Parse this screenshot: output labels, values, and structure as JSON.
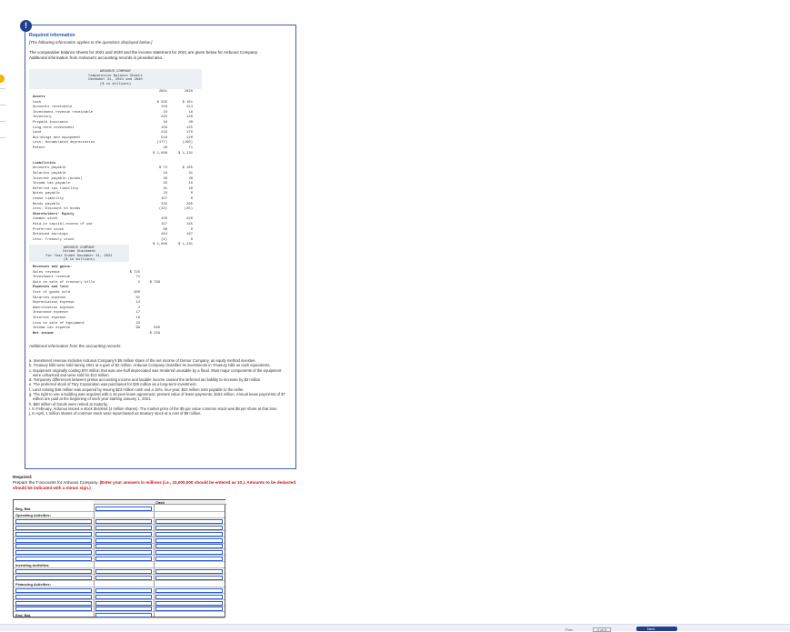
{
  "info": {
    "title": "Required information",
    "subtitle": "[The following information applies to the questions displayed below.]",
    "intro": "The comparative balance sheets for 2021 and 2020 and the income statement for 2021 are given below for Arduous Company. Additional information from Arduous's accounting records is provided also."
  },
  "balance_sheet": {
    "head": [
      "ARDUOUS COMPANY",
      "Comparative Balance Sheets",
      "December 31, 2021 and 2020",
      "($ in millions)"
    ],
    "years": [
      "2021",
      "2020"
    ],
    "rows": [
      {
        "label": "Assets",
        "a": "",
        "b": "",
        "bold": true
      },
      {
        "label": "Cash",
        "a": "$   335",
        "b": "$   161"
      },
      {
        "label": "Accounts receivable",
        "a": "210",
        "b": "214"
      },
      {
        "label": "Investment revenue receivable",
        "a": "24",
        "b": "16"
      },
      {
        "label": "Inventory",
        "a": "225",
        "b": "120"
      },
      {
        "label": "Prepaid insurance",
        "a": "16",
        "b": "28"
      },
      {
        "label": "Long-term investment",
        "a": "156",
        "b": "125"
      },
      {
        "label": "Land",
        "a": "216",
        "b": "170"
      },
      {
        "label": "Buildings and equipment",
        "a": "518",
        "b": "120"
      },
      {
        "label": "Less: Accumulated depreciation",
        "a": "(177)",
        "b": "(160)"
      },
      {
        "label": "Patent",
        "a": "40",
        "b": "71"
      },
      {
        "label": "",
        "a": "$ 1,606",
        "b": "$ 1,231"
      },
      {
        "label": "",
        "a": "",
        "b": ""
      },
      {
        "label": "Liabilities",
        "a": "",
        "b": "",
        "bold": true
      },
      {
        "label": "Accounts payable",
        "a": "$    73",
        "b": "$   185"
      },
      {
        "label": "Salaries payable",
        "a": "16",
        "b": "31"
      },
      {
        "label": "Interest payable (bonds)",
        "a": "28",
        "b": "26"
      },
      {
        "label": "Income tax payable",
        "a": "32",
        "b": "16"
      },
      {
        "label": "Deferred tax liability",
        "a": "31",
        "b": "28"
      },
      {
        "label": "Notes payable",
        "a": "23",
        "b": "0"
      },
      {
        "label": "Lease liability",
        "a": "157",
        "b": "0"
      },
      {
        "label": "Bonds payable",
        "a": "235",
        "b": "295"
      },
      {
        "label": "Less: Discount on bonds",
        "a": "(23)",
        "b": "(25)"
      },
      {
        "label": "Shareholders' Equity",
        "a": "",
        "b": "",
        "bold": true
      },
      {
        "label": "Common stock",
        "a": "420",
        "b": "420"
      },
      {
        "label": "Paid-in capital-excess of par",
        "a": "157",
        "b": "145"
      },
      {
        "label": "Preferred stock",
        "a": "96",
        "b": "0"
      },
      {
        "label": "Retained earnings",
        "a": "404",
        "b": "197"
      },
      {
        "label": "Less: Treasury stock",
        "a": "(9)",
        "b": "0"
      },
      {
        "label": "",
        "a": "$ 1,606",
        "b": "$ 1,231"
      }
    ]
  },
  "income_statement": {
    "head": [
      "ARDUOUS COMPANY",
      "Income Statement",
      "For Year Ended December 31, 2021",
      "($ in millions)"
    ],
    "rows": [
      {
        "label": "Revenues and gains:",
        "a": "",
        "b": "",
        "bold": true
      },
      {
        "label": "Sales revenue",
        "a": "$ 725",
        "b": ""
      },
      {
        "label": "Investment revenue",
        "a": "71",
        "b": ""
      },
      {
        "label": "Gain on sale of treasury bills",
        "a": "2",
        "b": "$ 798"
      },
      {
        "label": "Expenses and loss:",
        "a": "",
        "b": "",
        "bold": true
      },
      {
        "label": "Cost of goods sold",
        "a": "300",
        "b": ""
      },
      {
        "label": "Salaries expense",
        "a": "91",
        "b": ""
      },
      {
        "label": "Depreciation expense",
        "a": "12",
        "b": ""
      },
      {
        "label": "Amortization expense",
        "a": "2",
        "b": ""
      },
      {
        "label": "Insurance expense",
        "a": "17",
        "b": ""
      },
      {
        "label": "Interest expense",
        "a": "18",
        "b": ""
      },
      {
        "label": "Loss on sale of equipment",
        "a": "22",
        "b": ""
      },
      {
        "label": "Income tax expense",
        "a": "98",
        "b": "560"
      },
      {
        "label": "Net income",
        "a": "",
        "b": "$ 238",
        "bold": true
      }
    ]
  },
  "additional": {
    "title": "Additional information from the accounting records:",
    "notes": [
      "a. Investment revenue includes Arduous Company's $6 million share of the net income of Demur Company, an equity method investee.",
      "b. Treasury bills were sold during 2021 at a gain of $2 million. Arduous Company classifies its investments in Treasury bills as cash equivalents.",
      "c. Equipment originally costing $70 million that was one-half depreciated was rendered unusable by a flood. Most major components of the equipment were unharmed and were sold for $13 million.",
      "d. Temporary differences between pretax accounting income and taxable income caused the deferred tax liability to increase by $3 million.",
      "e. The preferred stock of Tory Corporation was purchased for $25 million as a long-term investment.",
      "f. Land costing $46 million was acquired by issuing $23 million cash and a 15%, four-year, $23 million note payable to the seller.",
      "g. The right to use a building was acquired with a 15-year lease agreement; present value of lease payments, $164 million. Annual lease payments of $7 million are paid at the beginning of each year starting January 1, 2021.",
      "h. $60 million of bonds were retired at maturity.",
      "i. In February, Arduous issued a stock dividend (4 million shares). The market price of the $5 par value common stock was $8 per share at that time.",
      "j. In April, 1 million shares of common stock were repurchased as treasury stock at a cost of $9 million."
    ]
  },
  "required": {
    "label": "Required:",
    "text": "Prepare the T-accounts for Arduous Company.",
    "instruction": "(Enter your answers in millions (i.e., 10,000,000 should be entered as 10.). Amounts to be deducted should be indicated with a minus sign.)"
  },
  "taccount": {
    "header": "Cash",
    "rows": [
      {
        "label": "Beg. Bal.",
        "inputs": false
      },
      {
        "label": "Operating Activities:",
        "inputs": false
      },
      {
        "label": "",
        "inputs": true
      },
      {
        "label": "",
        "inputs": true
      },
      {
        "label": "",
        "inputs": true
      },
      {
        "label": "",
        "inputs": true
      },
      {
        "label": "",
        "inputs": true
      },
      {
        "label": "",
        "inputs": true
      },
      {
        "label": "",
        "inputs": true
      },
      {
        "label": "Investing Activities:",
        "inputs": false
      },
      {
        "label": "",
        "inputs": true
      },
      {
        "label": "",
        "inputs": true
      },
      {
        "label": "Financing Activities:",
        "inputs": false
      },
      {
        "label": "",
        "inputs": true
      },
      {
        "label": "",
        "inputs": true
      },
      {
        "label": "",
        "inputs": true
      },
      {
        "label": "",
        "inputs": true
      },
      {
        "label": "End. Bal.",
        "inputs": false
      }
    ]
  },
  "footer": {
    "prev": "Prev",
    "pages": "2 of 4",
    "next": "Next"
  }
}
